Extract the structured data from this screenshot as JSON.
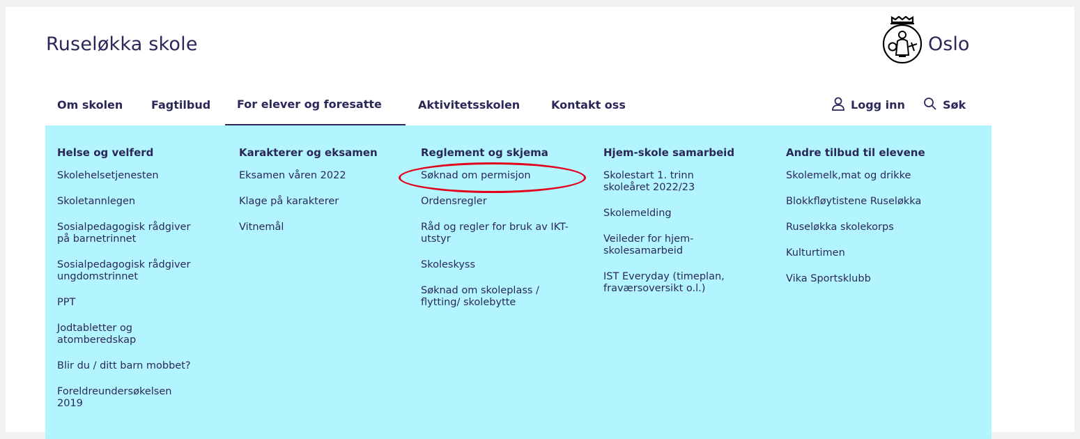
{
  "header": {
    "site_title": "Ruseløkka skole",
    "logo_text": "Oslo",
    "logo_icon": "oslo-seal-icon"
  },
  "nav": {
    "items": [
      {
        "label": "Om skolen"
      },
      {
        "label": "Fagtilbud"
      },
      {
        "label": "For elever og foresatte",
        "active": true
      },
      {
        "label": "Aktivitetsskolen"
      },
      {
        "label": "Kontakt oss"
      }
    ],
    "login_label": "Logg inn",
    "login_icon": "user-icon",
    "search_label": "Søk",
    "search_icon": "search-icon"
  },
  "mega_menu": {
    "background": "#b3f5ff",
    "columns": [
      {
        "heading": "Helse og velferd",
        "links": [
          "Skolehelsetjenesten",
          "Skoletannlegen",
          "Sosialpedagogisk rådgiver på barnetrinnet",
          "Sosialpedagogisk rådgiver ungdomstrinnet",
          "PPT",
          "Jodtabletter og atomberedskap",
          "Blir du / ditt barn mobbet?",
          "Foreldreundersøkelsen 2019"
        ]
      },
      {
        "heading": "Karakterer og eksamen",
        "links": [
          "Eksamen våren 2022",
          "Klage på karakterer",
          "Vitnemål"
        ]
      },
      {
        "heading": "Reglement og skjema",
        "links": [
          "Søknad om permisjon",
          "Ordensregler",
          "Råd og regler for bruk av IKT-utstyr",
          "Skoleskyss",
          "Søknad om skoleplass / flytting/ skolebytte"
        ]
      },
      {
        "heading": "Hjem-skole samarbeid",
        "links": [
          "Skolestart 1. trinn skoleåret 2022/23",
          "Skolemelding",
          "Veileder for hjem-skolesamarbeid",
          "IST Everyday (timeplan, fraværsoversikt o.l.)"
        ]
      },
      {
        "heading": "Andre tilbud til elevene",
        "links": [
          "Skolemelk,mat og drikke",
          "Blokkfløytistene Ruseløkka",
          "Ruseløkka skolekorps",
          "Kulturtimen",
          "Vika Sportsklubb"
        ]
      }
    ]
  },
  "annotation": {
    "highlighted_link": "Søknad om permisjon",
    "color": "#e3001b"
  },
  "colors": {
    "text": "#2a2859",
    "page_background": "#f2f2f2"
  }
}
